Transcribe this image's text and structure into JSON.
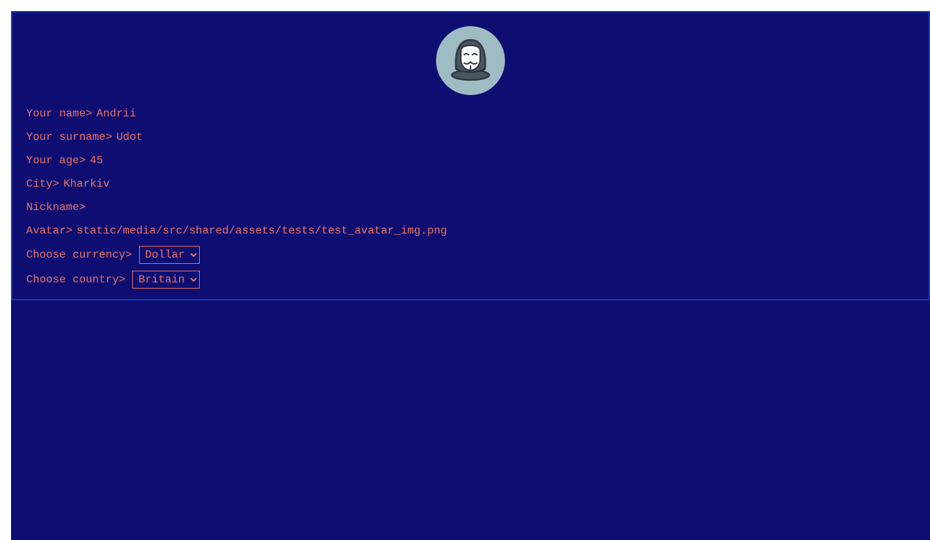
{
  "profile": {
    "avatar_icon": "anonymous-mask-hooded-figure-icon",
    "fields": [
      {
        "label": "Your name>",
        "value": "Andrii"
      },
      {
        "label": "Your surname>",
        "value": "Udot"
      },
      {
        "label": "Your age>",
        "value": "45"
      },
      {
        "label": "City>",
        "value": "Kharkiv"
      },
      {
        "label": "Nickname>",
        "value": ""
      },
      {
        "label": "Avatar>",
        "value": "static/media/src/shared/assets/tests/test_avatar_img.png"
      }
    ],
    "currency": {
      "label": "Choose currency>",
      "selected": "Dollar"
    },
    "country": {
      "label": "Choose country>",
      "selected": "Britain"
    }
  },
  "colors": {
    "background": "#0e0e72",
    "panel_border": "#1538b6",
    "text": "#f07060",
    "avatar_bg": "#9fbcc4"
  }
}
